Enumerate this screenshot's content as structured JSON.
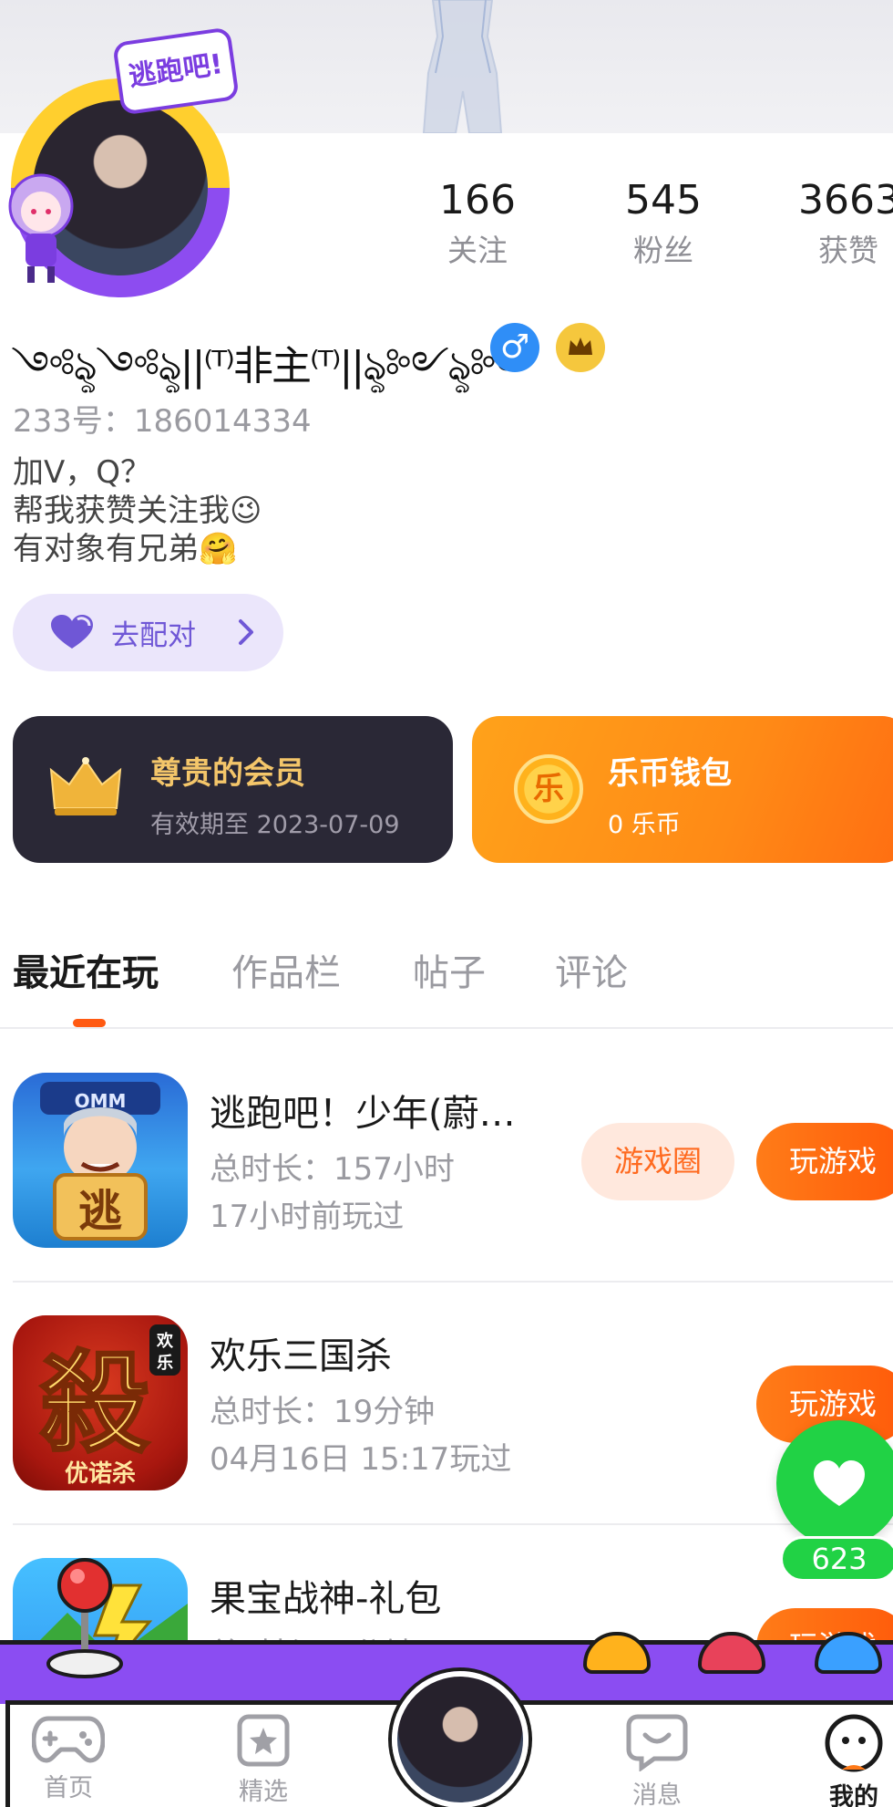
{
  "profile": {
    "badge_text": "逃跑吧!",
    "nickname": "༺ৡ༺ৡ||⁽ᵀ⁾非主⁽ᵀ⁾||ৡ༻ৡ༻",
    "gender_symbol": "♂",
    "uid_text": "233号：186014334",
    "bio_lines": [
      "加V，Q？",
      "帮我获赞关注我😉",
      "有对象有兄弟🤗"
    ],
    "match_label": "去配对"
  },
  "stats": [
    {
      "value": "166",
      "label": "关注"
    },
    {
      "value": "545",
      "label": "粉丝"
    },
    {
      "value": "3663",
      "label": "获赞"
    }
  ],
  "cards": {
    "member": {
      "title": "尊贵的会员",
      "subtitle": "有效期至 2023-07-09"
    },
    "wallet": {
      "title": "乐币钱包",
      "subtitle": "0 乐币",
      "coin_glyph": "乐"
    }
  },
  "tabs": [
    {
      "label": "最近在玩",
      "active": true
    },
    {
      "label": "作品栏",
      "active": false
    },
    {
      "label": "帖子",
      "active": false
    },
    {
      "label": "评论",
      "active": false
    }
  ],
  "games": [
    {
      "name": "逃跑吧！少年(蔚…",
      "duration": "总时长：157小时",
      "last_played": "17小时前玩过",
      "circle_label": "游戏圈",
      "play_label": "玩游戏",
      "icon_text": "逃",
      "icon_caption": "OMM"
    },
    {
      "name": "欢乐三国杀",
      "duration": "总时长：19分钟",
      "last_played": "04月16日 15:17玩过",
      "play_label": "玩游戏",
      "icon_text": "殺",
      "icon_caption": "优诺杀",
      "icon_corner": "欢乐"
    },
    {
      "name": "果宝战神-礼包",
      "duration": "总时长：8分钟",
      "play_label": "玩游戏"
    }
  ],
  "float_like": {
    "count": "623"
  },
  "nav": [
    {
      "label": "首页",
      "icon": "gamepad-icon"
    },
    {
      "label": "精选",
      "icon": "star-icon"
    },
    {
      "label": "",
      "icon": "avatar"
    },
    {
      "label": "消息",
      "icon": "chat-icon"
    },
    {
      "label": "我的",
      "icon": "face-icon",
      "active": true
    }
  ],
  "colors": {
    "accent": "#ff5a12",
    "purple": "#8b4df2",
    "green": "#21d245",
    "member_card": "#2a2836",
    "wallet_card": "#ff8a16"
  }
}
